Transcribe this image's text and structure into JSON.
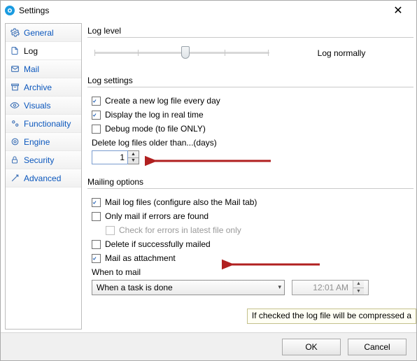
{
  "title": "Settings",
  "sidebar": {
    "items": [
      {
        "label": "General"
      },
      {
        "label": "Log"
      },
      {
        "label": "Mail"
      },
      {
        "label": "Archive"
      },
      {
        "label": "Visuals"
      },
      {
        "label": "Functionality"
      },
      {
        "label": "Engine"
      },
      {
        "label": "Security"
      },
      {
        "label": "Advanced"
      }
    ]
  },
  "log_level": {
    "group": "Log level",
    "mode_label": "Log normally"
  },
  "log_settings": {
    "group": "Log settings",
    "create_new": "Create a new log file every day",
    "realtime": "Display the log in real time",
    "debug": "Debug mode (to file ONLY)",
    "delete_label": "Delete log files older than...(days)",
    "delete_value": "1"
  },
  "mailing": {
    "group": "Mailing options",
    "mail_log": "Mail log files (configure also the Mail tab)",
    "only_errors": "Only mail if errors are found",
    "check_latest": "Check for errors in latest file only",
    "delete_ok": "Delete if successfully mailed",
    "as_attach": "Mail as attachment",
    "when_label": "When to mail",
    "when_value": "When a task is done",
    "time_value": "12:01 AM"
  },
  "tooltip": "If checked the log file will be compressed a",
  "buttons": {
    "ok": "OK",
    "cancel": "Cancel"
  }
}
